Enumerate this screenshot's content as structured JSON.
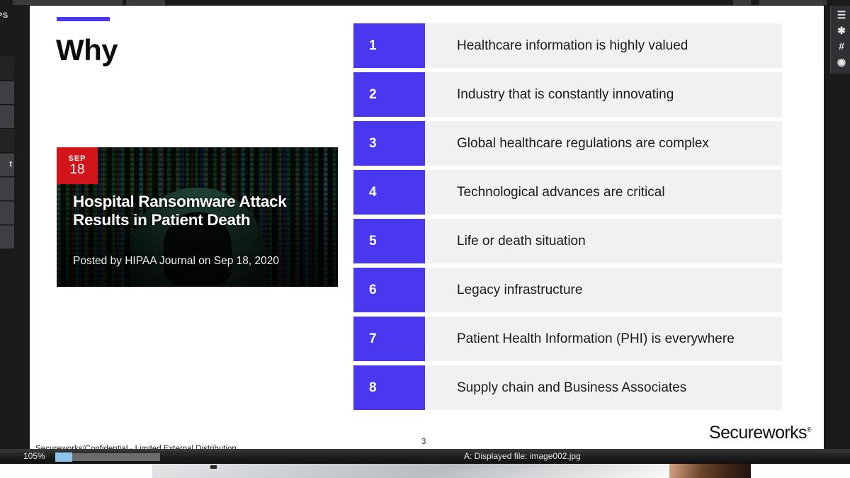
{
  "window": {
    "left_rail_label": "PS",
    "left_rail_item_label": "t",
    "right_rail_icons": [
      "list-icon",
      "star-icon",
      "grid-icon",
      "target-icon"
    ]
  },
  "slide": {
    "accent_color": "#4a37f0",
    "title": "Why",
    "page_number": "3",
    "footer_left": "Secureworks/Confidential - Limited External Distribution",
    "logo": "Secureworks",
    "logo_mark": "®",
    "article": {
      "date_month": "SEP",
      "date_day": "18",
      "headline": "Hospital Ransomware Attack Results in Patient Death",
      "byline": "Posted by HIPAA Journal on Sep 18, 2020",
      "badge_color": "#d2151a"
    },
    "list": [
      {
        "number": "1",
        "text": "Healthcare information is highly valued"
      },
      {
        "number": "2",
        "text": "Industry that is constantly innovating"
      },
      {
        "number": "3",
        "text": "Global healthcare regulations are complex"
      },
      {
        "number": "4",
        "text": "Technological advances are critical"
      },
      {
        "number": "5",
        "text": "Life or death situation"
      },
      {
        "number": "6",
        "text": "Legacy infrastructure"
      },
      {
        "number": "7",
        "text": "Patient Health Information (PHI) is everywhere"
      },
      {
        "number": "8",
        "text": "Supply chain and Business Associates"
      }
    ]
  },
  "statusbar": {
    "zoom_level": "105%",
    "displayed_file": "A: Displayed file: image002.jpg"
  }
}
